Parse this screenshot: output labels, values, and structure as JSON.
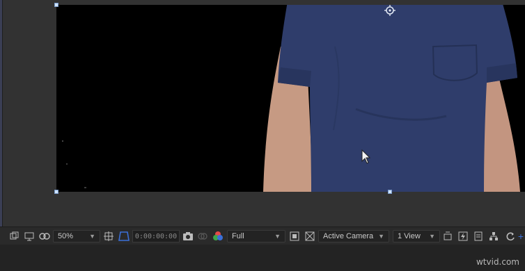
{
  "viewer": {
    "zoom": "50%",
    "timecode": "0:00:00:00",
    "resolution": "Full",
    "camera": "Active Camera",
    "views": "1 View"
  },
  "colors": {
    "canvas": "#000000",
    "shirt": "#2f3d6b",
    "skin": "#c79a82",
    "handle": "#cfe4ff",
    "accent_blue": "#3b6fd8"
  },
  "watermark": "wtvid.com"
}
